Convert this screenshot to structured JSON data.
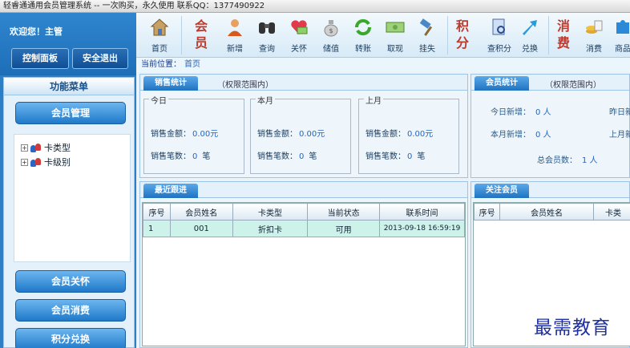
{
  "window": {
    "title": "轻睿通通用会员管理系统 -- 一次购买，永久使用 联系QQ：1377490922"
  },
  "welcome": {
    "text": "欢迎您！主管",
    "control_panel": "控制面板",
    "safe_exit": "安全退出"
  },
  "menu": {
    "header": "功能菜单",
    "member_mgmt": "会员管理",
    "tree": [
      {
        "label": "卡类型"
      },
      {
        "label": "卡级别"
      }
    ],
    "member_care": "会员关怀",
    "member_consume": "会员消费",
    "points_exchange": "积分兑换"
  },
  "toolbar": {
    "home": "首页",
    "group_member": [
      "会",
      "员"
    ],
    "add": "新增",
    "query": "查询",
    "care": "关怀",
    "store_value": "储值",
    "transfer": "转账",
    "withdraw": "取现",
    "report_loss": "挂失",
    "group_points": [
      "积",
      "分"
    ],
    "query_points": "查积分",
    "exchange": "兑换",
    "group_consume": [
      "消",
      "费"
    ],
    "consume": "消费",
    "goods": "商品"
  },
  "location": {
    "label": "当前位置：",
    "value": "首页"
  },
  "sales": {
    "tab": "销售统计",
    "note": "（权限范围内）",
    "today": "今日",
    "this_month": "本月",
    "last_month": "上月",
    "amount_label": "销售金额：",
    "count_label": "销售笔数：",
    "amount_value": "0.00元",
    "count_value": "0",
    "count_unit": "笔"
  },
  "member_stats": {
    "tab": "会员统计",
    "note": "（权限范围内）",
    "today_new_label": "今日新增：",
    "today_new_value": "0 人",
    "month_new_label": "本月新增：",
    "month_new_value": "0 人",
    "yesterday_label": "昨日新",
    "last_month_label": "上月新",
    "total_label": "总会员数：",
    "total_value": "1 人"
  },
  "recent": {
    "tab": "最近跟进",
    "columns": [
      "序号",
      "会员姓名",
      "卡类型",
      "当前状态",
      "联系时间"
    ],
    "rows": [
      {
        "no": "1",
        "name": "001",
        "card_type": "折扣卡",
        "status": "可用",
        "time": "2013-09-18 16:59:19"
      }
    ]
  },
  "follow": {
    "tab": "关注会员",
    "columns": [
      "序号",
      "会员姓名",
      "卡类"
    ]
  },
  "watermark": "最需教育",
  "colors": {
    "accent": "#1f79c9",
    "group_text": "#c0392b",
    "highlight_row": "#cdf2ea"
  }
}
